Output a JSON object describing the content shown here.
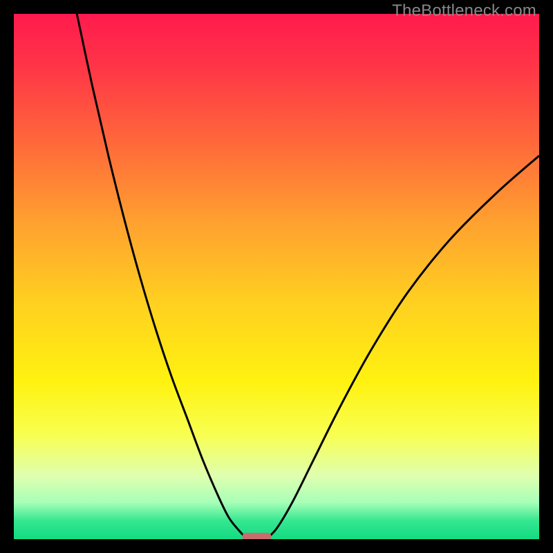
{
  "watermark": "TheBottleneck.com",
  "chart_data": {
    "type": "line",
    "title": "",
    "xlabel": "",
    "ylabel": "",
    "xlim": [
      0,
      100
    ],
    "ylim": [
      0,
      100
    ],
    "series": [
      {
        "name": "left-curve",
        "x": [
          12,
          15,
          18,
          21,
          24,
          27,
          30,
          33,
          36,
          39,
          41,
          43,
          44,
          45
        ],
        "y": [
          100,
          86,
          73,
          61,
          50,
          40,
          31,
          23,
          15,
          8,
          4,
          1.5,
          0.5,
          0
        ]
      },
      {
        "name": "right-curve",
        "x": [
          48,
          50,
          53,
          57,
          62,
          68,
          75,
          83,
          92,
          100
        ],
        "y": [
          0,
          2,
          7,
          15,
          25,
          36,
          47,
          57,
          66,
          73
        ]
      }
    ],
    "marker": {
      "name": "bottleneck-marker",
      "x_start": 43.5,
      "x_end": 49,
      "y": 0.5,
      "color": "#c76d6d"
    },
    "background_gradient": {
      "stops": [
        {
          "offset": 0.0,
          "color": "#ff1a4d"
        },
        {
          "offset": 0.1,
          "color": "#ff3547"
        },
        {
          "offset": 0.25,
          "color": "#ff6a3a"
        },
        {
          "offset": 0.4,
          "color": "#ffa22f"
        },
        {
          "offset": 0.55,
          "color": "#ffd020"
        },
        {
          "offset": 0.7,
          "color": "#fff210"
        },
        {
          "offset": 0.8,
          "color": "#f8ff50"
        },
        {
          "offset": 0.88,
          "color": "#dfffb0"
        },
        {
          "offset": 0.93,
          "color": "#a8ffb8"
        },
        {
          "offset": 0.965,
          "color": "#35e790"
        },
        {
          "offset": 1.0,
          "color": "#13db82"
        }
      ]
    }
  }
}
